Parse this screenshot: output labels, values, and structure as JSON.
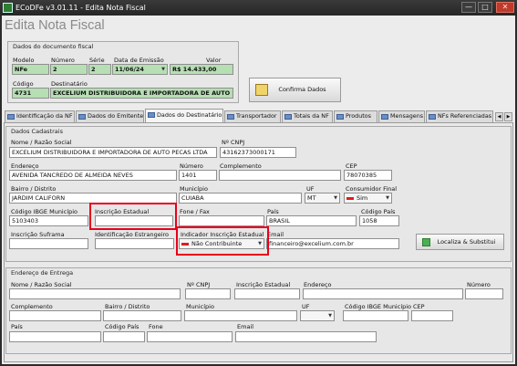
{
  "window": {
    "title": "ECoDFe v3.01.11 - Edita Nota Fiscal",
    "minimize": "—",
    "maximize": "□",
    "close": "✕"
  },
  "header": {
    "title": "Edita Nota Fiscal"
  },
  "doc": {
    "title": "Dados do documento fiscal",
    "modelo_label": "Modelo",
    "modelo": "NFe",
    "numero_label": "Número",
    "numero": "2",
    "serie_label": "Série",
    "serie": "2",
    "data_label": "Data de Emissão",
    "data": "11/06/24",
    "valor_label": "Valor",
    "valor": "R$ 14.433,00",
    "codigo_label": "Código",
    "codigo": "4731",
    "dest_label": "Destinatário",
    "dest": "EXCELIUM DISTRIBUIDORA E IMPORTADORA DE AUTO PEÇ"
  },
  "confirm_label": "Confirma Dados",
  "tabs": [
    "Identificação da NF",
    "Dados do Emitente",
    "Dados do Destinatário",
    "Transportador",
    "Totais da NF",
    "Produtos",
    "Mensagens",
    "NFs Referenciadas"
  ],
  "cad": {
    "title": "Dados Cadastrais",
    "nome_label": "Nome / Razão Social",
    "nome": "EXCELIUM DISTRIBUIDORA E IMPORTADORA DE AUTO PECAS LTDA",
    "cnpj_label": "Nº CNPJ",
    "cnpj": "43162373000171",
    "end_label": "Endereço",
    "end": "AVENIDA TANCREDO DE ALMEIDA NEVES",
    "num_label": "Número",
    "num": "1401",
    "comp_label": "Complemento",
    "comp": "",
    "cep_label": "CEP",
    "cep": "78070385",
    "bairro_label": "Bairro / Distrito",
    "bairro": "JARDIM CALIFORN",
    "mun_label": "Município",
    "mun": "CUIABA",
    "uf_label": "UF",
    "uf": "MT",
    "cf_label": "Consumidor Final",
    "cf": "Sim",
    "ibge_label": "Código IBGE Município",
    "ibge": "5103403",
    "ie_label": "Inscrição Estadual",
    "ie": "",
    "fone_label": "Fone / Fax",
    "fone": "",
    "pais_label": "País",
    "pais": "BRASIL",
    "codpais_label": "Código País",
    "codpais": "1058",
    "sufr_label": "Inscrição Suframa",
    "sufr": "",
    "idest_label": "Identificação Estrangeiro",
    "idest": "",
    "ind_label": "Indicador Inscrição Estadual",
    "ind": "Não Contribuinte",
    "email_label": "Email",
    "email": "financeiro@excelium.com.br",
    "localiza": "Localiza & Substitui"
  },
  "ent": {
    "title": "Endereço de Entrega",
    "nome_label": "Nome / Razão Social",
    "cnpj_label": "Nº CNPJ",
    "ie_label": "Inscrição Estadual",
    "end_label": "Endereço",
    "num_label": "Número",
    "comp_label": "Complemento",
    "bairro_label": "Bairro / Distrito",
    "mun_label": "Município",
    "uf_label": "UF",
    "ibge_label": "Código IBGE Município",
    "cep_label": "CEP",
    "pais_label": "País",
    "codpais_label": "Código País",
    "fone_label": "Fone",
    "email_label": "Email"
  }
}
